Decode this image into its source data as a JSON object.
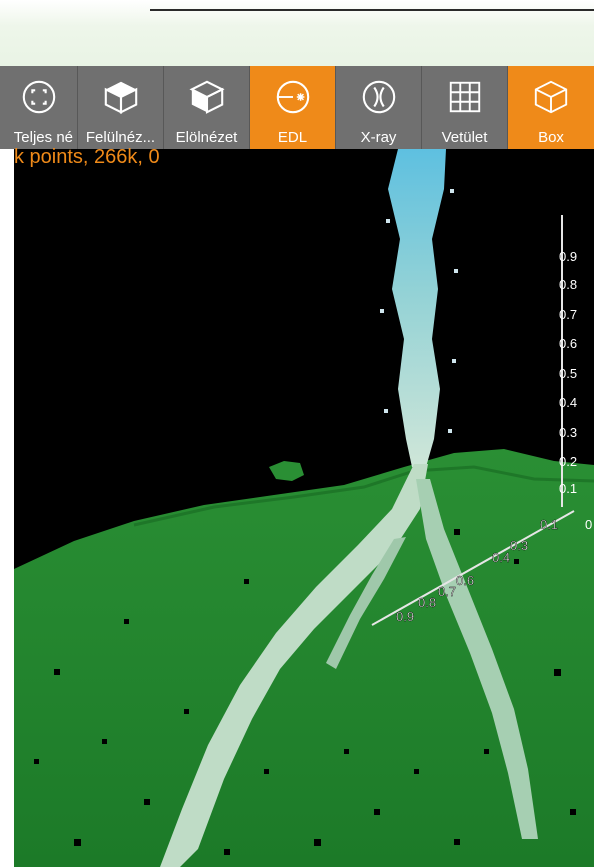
{
  "toolbar": {
    "items": [
      {
        "label": "Teljes né",
        "icon": "fullscreen-icon",
        "active": false
      },
      {
        "label": "Felülnéz...",
        "icon": "top-view-cube-icon",
        "active": false
      },
      {
        "label": "Elölnézet",
        "icon": "front-view-cube-icon",
        "active": false
      },
      {
        "label": "EDL",
        "icon": "edl-light-icon",
        "active": true
      },
      {
        "label": "X-ray",
        "icon": "xray-icon",
        "active": false
      },
      {
        "label": "Vetület",
        "icon": "grid-projection-icon",
        "active": false
      },
      {
        "label": "Box",
        "icon": "box-cube-icon",
        "active": true
      }
    ]
  },
  "status_text": "k points, 266k, 0",
  "axes": {
    "vertical_ticks": [
      "0.9",
      "0.8",
      "0.7",
      "0.6",
      "0.5",
      "0.4",
      "0.3",
      "0.2",
      "0.1"
    ],
    "depth_ticks": [
      "0.1",
      "0.3",
      "0.4",
      "0.6",
      "0.7",
      "0.8",
      "0.9"
    ],
    "corner_label": "0"
  },
  "colors": {
    "accent": "#ef8a19",
    "toolbar_bg": "#707070",
    "terrain": "#1f8a2e",
    "stream_top": "#5ec0e0",
    "stream_bottom": "#cfe6d8"
  }
}
